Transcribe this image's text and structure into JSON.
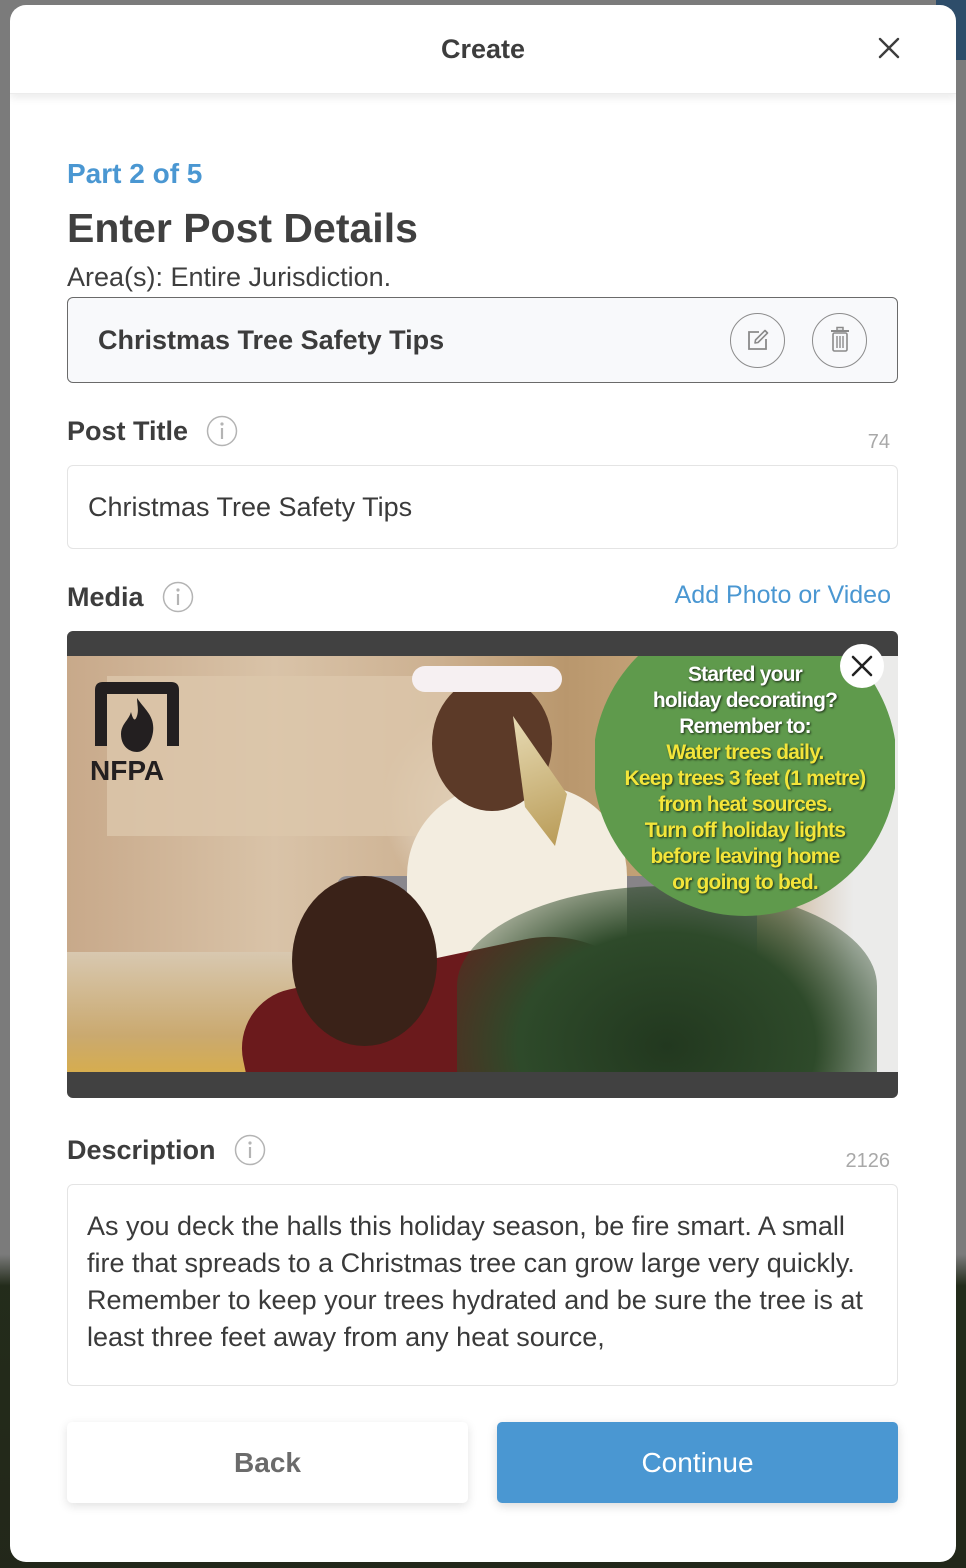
{
  "modal": {
    "title": "Create",
    "close_icon": "close-icon"
  },
  "step": {
    "label": "Part 2 of 5"
  },
  "page": {
    "title": "Enter Post Details",
    "area": "Area(s): Entire Jurisdiction."
  },
  "template_card": {
    "name": "Christmas Tree Safety Tips",
    "edit_icon": "edit-icon",
    "delete_icon": "trash-icon"
  },
  "post_title": {
    "label": "Post Title",
    "info_icon": "info-icon",
    "remaining_chars": "74",
    "value": "Christmas Tree Safety Tips"
  },
  "media": {
    "label": "Media",
    "info_icon": "info-icon",
    "add_link": "Add Photo or Video",
    "remove_icon": "close-icon",
    "image": {
      "logo_text": "NFPA",
      "tip_lines": [
        {
          "text": "Started your",
          "color": "white"
        },
        {
          "text": "holiday decorating?",
          "color": "white"
        },
        {
          "text": "Remember to:",
          "color": "white"
        },
        {
          "text": "Water trees daily.",
          "color": "yellow"
        },
        {
          "text": "Keep trees 3 feet (1 metre)",
          "color": "yellow"
        },
        {
          "text": "from heat sources.",
          "color": "yellow"
        },
        {
          "text": "Turn off holiday lights",
          "color": "yellow"
        },
        {
          "text": "before leaving home",
          "color": "yellow"
        },
        {
          "text": "or going to bed.",
          "color": "yellow"
        }
      ]
    }
  },
  "description": {
    "label": "Description",
    "info_icon": "info-icon",
    "remaining_chars": "2126",
    "value": "As you deck the halls this holiday season, be fire smart. A small fire that spreads to a Christmas tree can grow large very quickly. Remember to keep your trees hydrated and be sure the tree is at least three feet away from any heat source,"
  },
  "actions": {
    "back_label": "Back",
    "continue_label": "Continue"
  },
  "colors": {
    "accent": "#4a97d2",
    "text_dark": "#3d3d3d",
    "muted": "#a8a8a8",
    "media_frame": "#414141",
    "tip_bubble_green": "#5f9a4c",
    "tip_yellow": "#f3e53a"
  }
}
